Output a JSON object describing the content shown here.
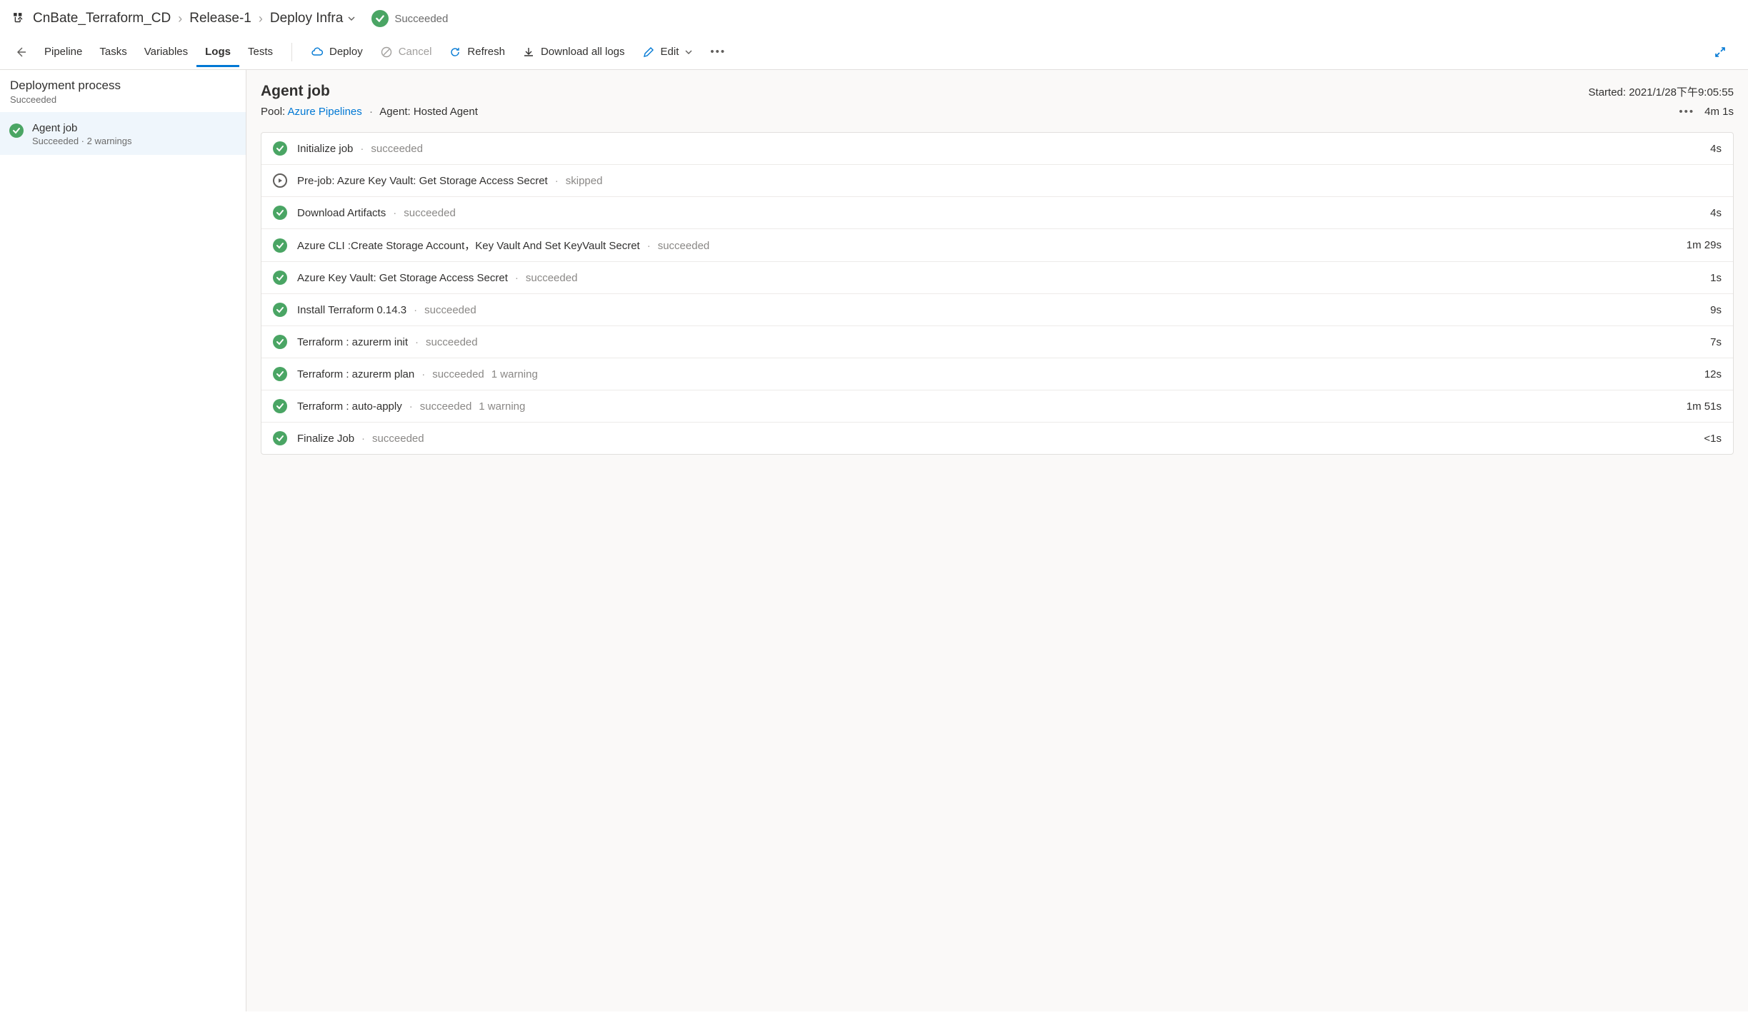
{
  "breadcrumb": {
    "project": "CnBate_Terraform_CD",
    "release": "Release-1",
    "stage": "Deploy Infra",
    "status": "Succeeded"
  },
  "tabs": {
    "pipeline": "Pipeline",
    "tasks": "Tasks",
    "variables": "Variables",
    "logs": "Logs",
    "tests": "Tests"
  },
  "actions": {
    "deploy": "Deploy",
    "cancel": "Cancel",
    "refresh": "Refresh",
    "download": "Download all logs",
    "edit": "Edit"
  },
  "sidebar": {
    "title": "Deployment process",
    "status": "Succeeded",
    "items": [
      {
        "title": "Agent job",
        "sub": "Succeeded · 2 warnings"
      }
    ]
  },
  "job": {
    "title": "Agent job",
    "startedLabel": "Started: 2021/1/28下午9:05:55",
    "poolLabel": "Pool:",
    "poolName": "Azure Pipelines",
    "agentLabel": "Agent: Hosted Agent",
    "duration": "4m 1s"
  },
  "steps": [
    {
      "name": "Initialize job",
      "status": "succeeded",
      "state": "success",
      "warn": "",
      "dur": "4s"
    },
    {
      "name": "Pre-job: Azure Key Vault: Get Storage Access Secret",
      "status": "skipped",
      "state": "skipped",
      "warn": "",
      "dur": ""
    },
    {
      "name": "Download Artifacts",
      "status": "succeeded",
      "state": "success",
      "warn": "",
      "dur": "4s"
    },
    {
      "name": "Azure CLI :Create Storage Account，Key Vault And Set KeyVault Secret",
      "status": "succeeded",
      "state": "success",
      "warn": "",
      "dur": "1m 29s"
    },
    {
      "name": "Azure Key Vault: Get Storage Access Secret",
      "status": "succeeded",
      "state": "success",
      "warn": "",
      "dur": "1s"
    },
    {
      "name": "Install Terraform 0.14.3",
      "status": "succeeded",
      "state": "success",
      "warn": "",
      "dur": "9s"
    },
    {
      "name": "Terraform : azurerm init",
      "status": "succeeded",
      "state": "success",
      "warn": "",
      "dur": "7s"
    },
    {
      "name": "Terraform : azurerm plan",
      "status": "succeeded",
      "state": "success",
      "warn": "1 warning",
      "dur": "12s"
    },
    {
      "name": "Terraform : auto-apply",
      "status": "succeeded",
      "state": "success",
      "warn": "1 warning",
      "dur": "1m 51s"
    },
    {
      "name": "Finalize Job",
      "status": "succeeded",
      "state": "success",
      "warn": "",
      "dur": "<1s"
    }
  ]
}
